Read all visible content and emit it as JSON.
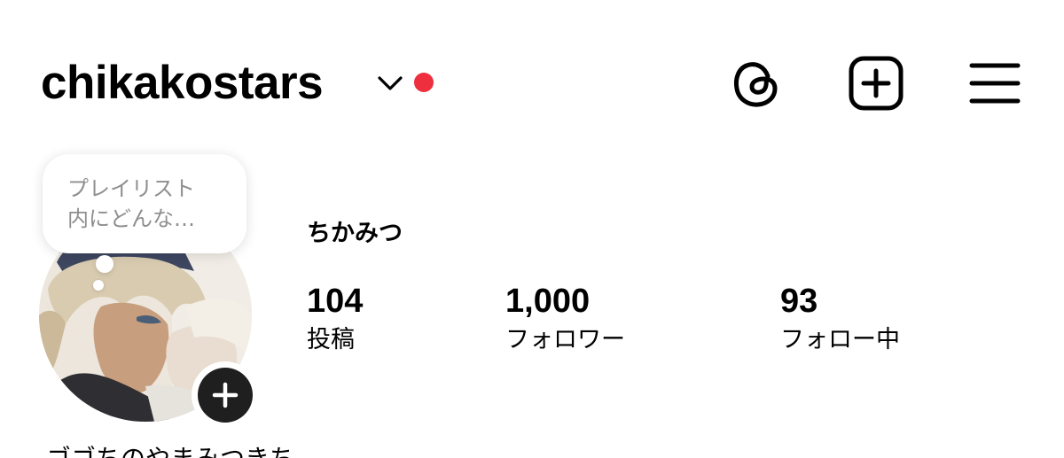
{
  "header": {
    "username": "chikakostars",
    "notification_dot_color": "#ed2f3e",
    "icons": [
      "threads-icon",
      "create-post-icon",
      "menu-icon"
    ]
  },
  "note": {
    "text": "プレイリスト\n内にどんな…"
  },
  "profile": {
    "display_name": "ちかみつ",
    "bio_partial": "ゴゴちのやまみつきち"
  },
  "stats": {
    "posts": {
      "count": "104",
      "label": "投稿"
    },
    "followers": {
      "count": "1,000",
      "label": "フォロワー"
    },
    "following": {
      "count": "93",
      "label": "フォロー中"
    }
  },
  "colors": {
    "text": "#000000",
    "note_text": "#8e8e8e",
    "add_button": "#1f1f1f"
  }
}
